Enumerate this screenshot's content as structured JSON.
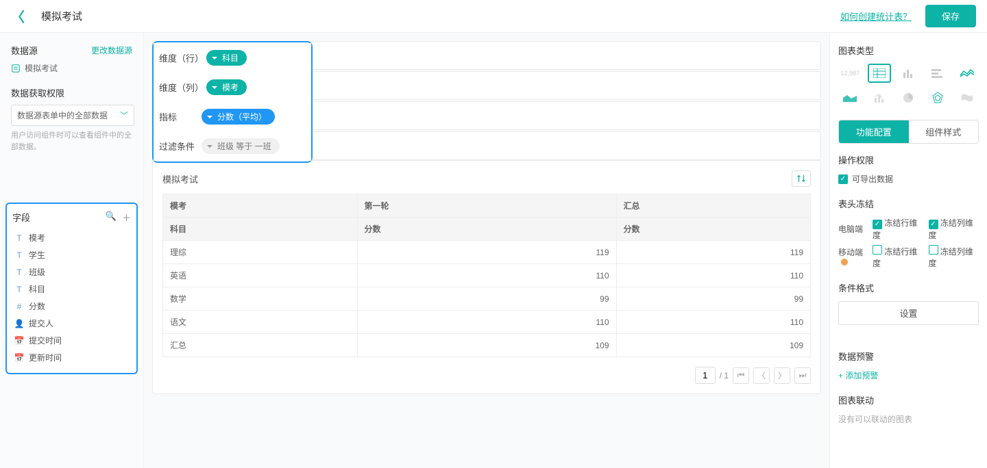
{
  "topbar": {
    "title": "模拟考试",
    "help_link": "如何创建统计表？",
    "save_label": "保存"
  },
  "left": {
    "datasource_heading": "数据源",
    "change_datasource": "更改数据源",
    "datasource_name": "模拟考试",
    "permission_heading": "数据获取权限",
    "permission_value": "数据源表单中的全部数据",
    "permission_hint": "用户访问组件时可以查看组件中的全部数据。",
    "fields_heading": "字段",
    "fields": [
      {
        "icon": "T",
        "label": "模考"
      },
      {
        "icon": "T",
        "label": "学生"
      },
      {
        "icon": "T",
        "label": "班级"
      },
      {
        "icon": "T",
        "label": "科目"
      },
      {
        "icon": "#",
        "label": "分数"
      },
      {
        "icon": "user",
        "label": "提交人"
      },
      {
        "icon": "cal",
        "label": "提交时间"
      },
      {
        "icon": "cal",
        "label": "更新时间"
      }
    ]
  },
  "config": {
    "rows": [
      {
        "label": "维度（行）",
        "pill": "科目",
        "style": "teal"
      },
      {
        "label": "维度（列）",
        "pill": "模考",
        "style": "teal"
      },
      {
        "label": "指标",
        "pill": "分数（平均）",
        "style": "blue"
      },
      {
        "label": "过滤条件",
        "pill": "班级 等于 一班",
        "style": "filter"
      }
    ]
  },
  "table": {
    "title": "模拟考试",
    "header_rows": [
      [
        "模考",
        "第一轮",
        "汇总"
      ],
      [
        "科目",
        "分数",
        "分数"
      ]
    ],
    "body_rows": [
      [
        "理综",
        "119",
        "119"
      ],
      [
        "英语",
        "110",
        "110"
      ],
      [
        "数学",
        "99",
        "99"
      ],
      [
        "语文",
        "110",
        "110"
      ],
      [
        "汇总",
        "109",
        "109"
      ]
    ],
    "pager": {
      "current": "1",
      "sep": "/ 1"
    }
  },
  "right": {
    "charttype_heading": "图表类型",
    "tabs": {
      "config": "功能配置",
      "style": "组件样式"
    },
    "perm_heading": "操作权限",
    "perm_export": "可导出数据",
    "freeze_heading": "表头冻结",
    "freeze_labels": {
      "pc": "电脑端",
      "mobile": "移动端",
      "row": "冻结行维度",
      "col": "冻结列维度"
    },
    "cond_heading": "条件格式",
    "cond_set_btn": "设置",
    "alert_heading": "数据预警",
    "alert_add": "+ 添加预警",
    "link_heading": "图表联动",
    "link_empty": "没有可以联动的图表"
  },
  "chart_data": {
    "type": "table",
    "title": "模拟考试",
    "row_dimension": "科目",
    "col_dimension": "模考",
    "metric": "分数（平均）",
    "filter": "班级 等于 一班",
    "columns": [
      "第一轮",
      "汇总"
    ],
    "rows": [
      {
        "科目": "理综",
        "第一轮": 119,
        "汇总": 119
      },
      {
        "科目": "英语",
        "第一轮": 110,
        "汇总": 110
      },
      {
        "科目": "数学",
        "第一轮": 99,
        "汇总": 99
      },
      {
        "科目": "语文",
        "第一轮": 110,
        "汇总": 110
      },
      {
        "科目": "汇总",
        "第一轮": 109,
        "汇总": 109
      }
    ]
  }
}
